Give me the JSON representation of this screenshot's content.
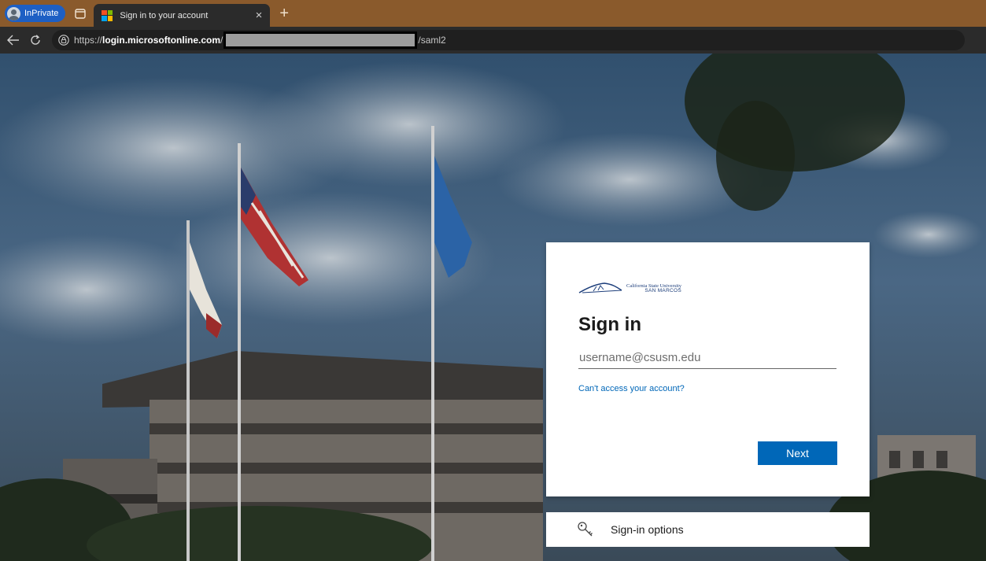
{
  "browser": {
    "inprivate_label": "InPrivate",
    "active_tab": {
      "title": "Sign in to your account",
      "close_glyph": "×"
    },
    "new_tab_glyph": "+",
    "address": {
      "scheme": "https://",
      "domain": "login.microsoftonline.com",
      "slash": "/",
      "tail": "/saml2"
    },
    "icons": [
      "tab-actions-icon",
      "back-arrow-icon",
      "refresh-icon",
      "lock-icon"
    ]
  },
  "signin": {
    "logo": {
      "line1": "California State University",
      "line2": "SAN MARCOS"
    },
    "title": "Sign in",
    "username": {
      "placeholder": "username@csusm.edu",
      "value": ""
    },
    "cant_access_link": "Can't access your account?",
    "next_button": "Next"
  },
  "options": {
    "label": "Sign-in options",
    "icon": "key-icon"
  },
  "colors": {
    "tabbar": "#8a5a2c",
    "inprivate_pill": "#1d5fc4",
    "accent": "#0067b8"
  }
}
